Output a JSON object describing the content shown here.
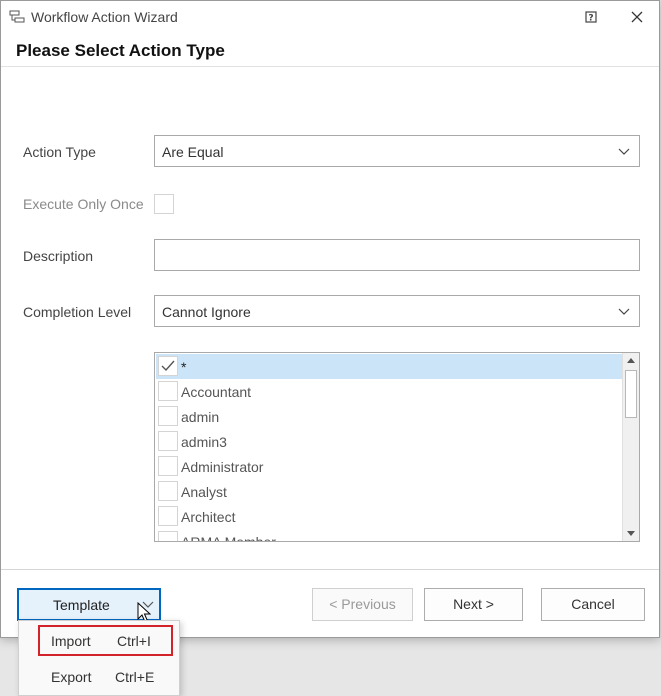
{
  "window": {
    "title": "Workflow Action Wizard",
    "heading": "Please Select Action Type"
  },
  "form": {
    "action_type": {
      "label": "Action Type",
      "value": "Are Equal"
    },
    "execute_only_once": {
      "label": "Execute Only Once",
      "checked": false
    },
    "description": {
      "label": "Description",
      "value": ""
    },
    "completion_level": {
      "label": "Completion Level",
      "value": "Cannot Ignore"
    }
  },
  "roles_list": {
    "items": [
      {
        "label": "*",
        "checked": true,
        "selected": true
      },
      {
        "label": "Accountant",
        "checked": false
      },
      {
        "label": "admin",
        "checked": false
      },
      {
        "label": "admin3",
        "checked": false
      },
      {
        "label": "Administrator",
        "checked": false
      },
      {
        "label": "Analyst",
        "checked": false
      },
      {
        "label": "Architect",
        "checked": false
      },
      {
        "label": "ARMA Member",
        "checked": false
      }
    ]
  },
  "footer": {
    "template_label": "Template",
    "previous_label": "< Previous",
    "next_label": "Next >",
    "cancel_label": "Cancel"
  },
  "template_menu": {
    "items": [
      {
        "label": "Import",
        "shortcut": "Ctrl+I"
      },
      {
        "label": "Export",
        "shortcut": "Ctrl+E"
      }
    ]
  },
  "colors": {
    "selection": "#cce4f7",
    "focus_border": "#0067c0",
    "highlight_box": "#d2232a"
  }
}
